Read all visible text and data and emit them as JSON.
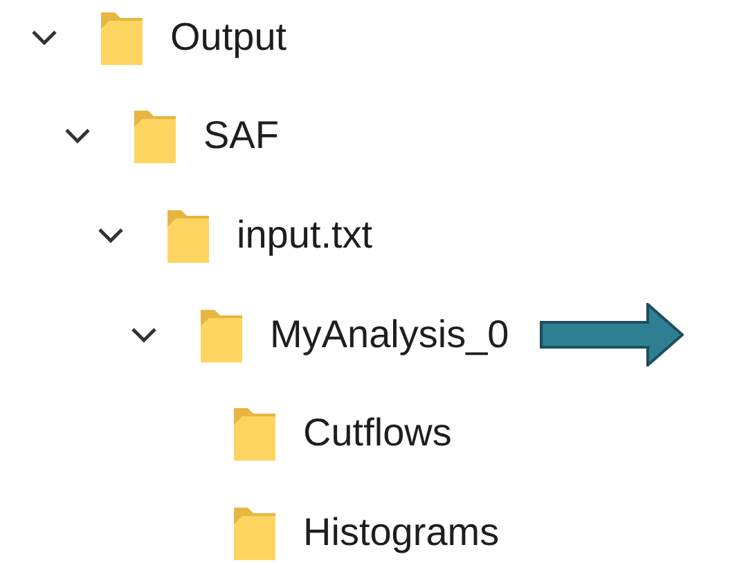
{
  "tree": [
    {
      "label": "Output",
      "expanded": true,
      "children": [
        {
          "label": "SAF",
          "expanded": true,
          "children": [
            {
              "label": "input.txt",
              "expanded": true,
              "children": [
                {
                  "label": "MyAnalysis_0",
                  "expanded": true,
                  "pointer": true,
                  "children": [
                    {
                      "label": "Cutflows"
                    },
                    {
                      "label": "Histograms"
                    }
                  ]
                }
              ]
            }
          ]
        }
      ]
    }
  ]
}
